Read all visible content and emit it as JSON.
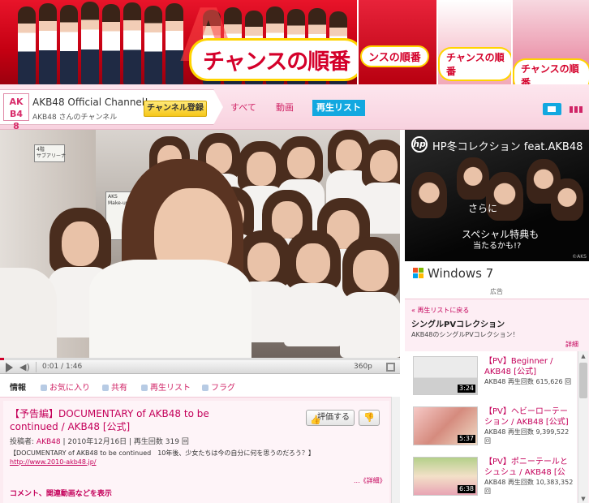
{
  "banner": {
    "logo_main": "チャンスの順番",
    "logo_repeat": "チャンスの順番",
    "logo_repeat_short": "ンスの順番"
  },
  "channel": {
    "logo_text": "AKB48",
    "name": "AKB48 Official Channel!",
    "subtitle": "AKB48 さんのチャンネル",
    "subscribe_label": "チャンネル登録",
    "tabs": [
      {
        "label": "すべて"
      },
      {
        "label": "動画"
      },
      {
        "label": "再生リスト"
      }
    ]
  },
  "player": {
    "sign_text_1": "4階\nサブアリーナ",
    "sign_text_2": "AKS\nMake-up",
    "time_display": "0:01 / 1:46",
    "quality": "360p",
    "progress_fraction": 0.01
  },
  "actions": [
    {
      "label": "情報"
    },
    {
      "label": "お気に入り"
    },
    {
      "label": "共有"
    },
    {
      "label": "再生リスト"
    },
    {
      "label": "フラグ"
    }
  ],
  "video": {
    "title": "【予告編】DOCUMENTARY of AKB48 to be continued / AKB48 [公式]",
    "rate_label": "評価する",
    "uploader_prefix": "投稿者:",
    "uploader": "AKB48",
    "date_views": " | 2010年12月16日 | 再生回数 319 回",
    "description": "【DOCUMENTARY of AKB48 to be continued　10年後、少女たちは今の自分に何を思うのだろう？】",
    "url": "http://www.2010-akb48.jp/",
    "more_label": "...《詳細》",
    "show_comments": "コメント、関連動画などを表示"
  },
  "ad": {
    "brand": "hp",
    "title": "HP冬コレクション feat.AKB48",
    "copy_1": "さらに",
    "copy_2": "スペシャル特典も",
    "copy_3": "当たるかも!?",
    "credit": "©AKS",
    "windows_text": "Windows 7",
    "label": "広告"
  },
  "playlist": {
    "back_label": "« 再生リストに戻る",
    "title": "シングルPVコレクション",
    "subtitle": "AKB48のシングルPVコレクション！",
    "detail_label": "詳細",
    "items": [
      {
        "title": "【PV】Beginner / AKB48 [公式]",
        "author": "AKB48",
        "views": "再生回数 615,626 回",
        "duration": "3:24"
      },
      {
        "title": "【PV】ヘビーローテーション / AKB48 [公式]",
        "author": "AKB48",
        "views": "再生回数 9,399,522 回",
        "duration": "5:37"
      },
      {
        "title": "【PV】ポニーテールとシュシュ / AKB48 [公",
        "author": "AKB48",
        "views": "再生回数 10,383,352 回",
        "duration": "6:38"
      }
    ]
  },
  "colors": {
    "accent_pink": "#c4005a",
    "banner_red": "#c40012",
    "tab_blue": "#12a8e0",
    "subscribe_yellow": "#f6c71a"
  }
}
